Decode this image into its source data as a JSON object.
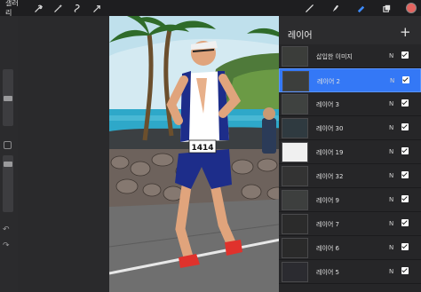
{
  "toolbar": {
    "gallery_label": "갤러리",
    "left_tools": [
      "wrench-icon",
      "magic-wand-icon",
      "selection-icon",
      "transform-icon"
    ],
    "right_tools": [
      "brush-icon",
      "smudge-icon",
      "eraser-icon",
      "layers-icon"
    ],
    "active_tool": "eraser-icon",
    "active_color": "#e4645f"
  },
  "sidebar": {
    "brush_size_level": 0.3,
    "opacity_level": 0.4,
    "undo_icon": "undo-icon",
    "redo_icon": "redo-icon"
  },
  "canvas": {
    "bib_number": "1414"
  },
  "layers": {
    "title": "레이어",
    "add_icon": "plus-icon",
    "items": [
      {
        "name": "삽입한 이미지",
        "mode": "N",
        "visible": true,
        "selected": false
      },
      {
        "name": "레이어 2",
        "mode": "N",
        "visible": true,
        "selected": true
      },
      {
        "name": "레이어 3",
        "mode": "N",
        "visible": true,
        "selected": false
      },
      {
        "name": "레이어 30",
        "mode": "N",
        "visible": true,
        "selected": false
      },
      {
        "name": "레이어 19",
        "mode": "N",
        "visible": true,
        "selected": false
      },
      {
        "name": "레이어 32",
        "mode": "N",
        "visible": true,
        "selected": false
      },
      {
        "name": "레이어 9",
        "mode": "N",
        "visible": true,
        "selected": false
      },
      {
        "name": "레이어 7",
        "mode": "N",
        "visible": true,
        "selected": false
      },
      {
        "name": "레이어 6",
        "mode": "N",
        "visible": true,
        "selected": false
      },
      {
        "name": "레이어 5",
        "mode": "N",
        "visible": true,
        "selected": false
      }
    ]
  }
}
